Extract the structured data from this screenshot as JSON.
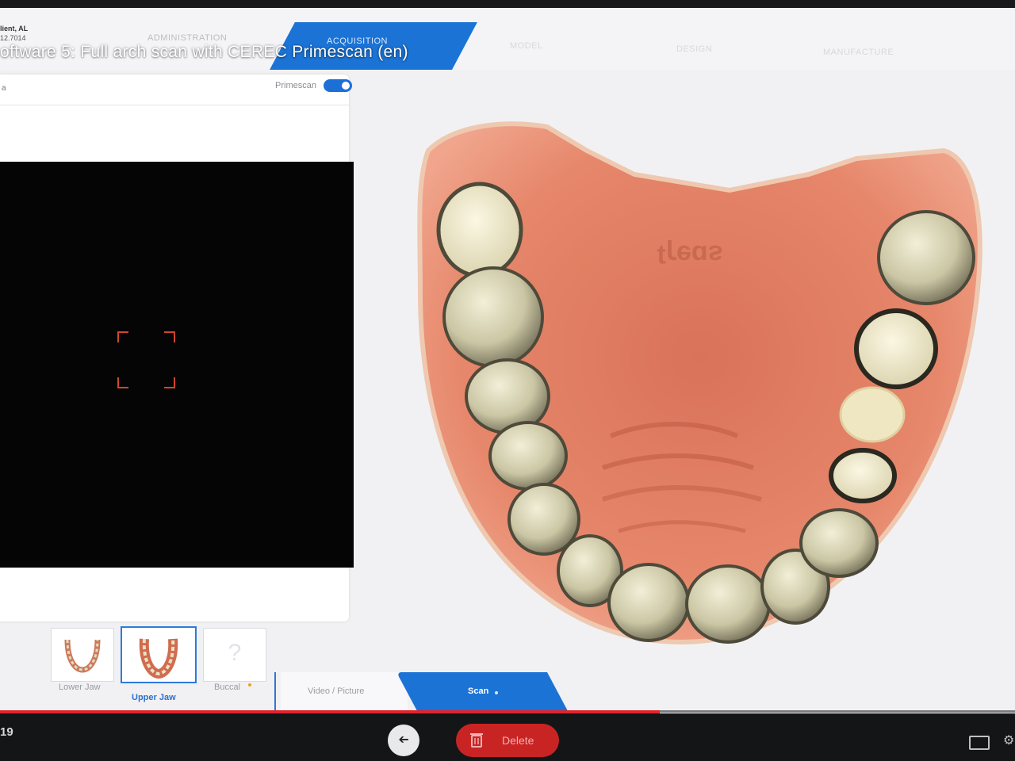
{
  "topbar": {
    "patient_name": "lient, AL",
    "patient_meta": "12.7014",
    "steps": {
      "administration": "ADMINISTRATION",
      "acquisition": "ACQUISITION",
      "model": "MODEL",
      "design": "DESIGN",
      "manufacture": "MANUFACTURE"
    },
    "overlay_title": "oftware 5: Full arch scan with CEREC Primescan (en)"
  },
  "camera_panel": {
    "header_label": "a",
    "device_label": "Primescan",
    "device_toggle_on": true
  },
  "catalog": {
    "lower_jaw": "Lower Jaw",
    "upper_jaw": "Upper Jaw",
    "buccal": "Buccal",
    "buccal_placeholder": "?"
  },
  "workflow": {
    "video_picture": "Video / Picture",
    "scan": "Scan"
  },
  "bottombar": {
    "time": "19",
    "back_symbol": "➔",
    "delete": "Delete"
  },
  "colors": {
    "accent": "#1b73d6",
    "delete": "#c92424",
    "progress": "#e0242c",
    "gum": "#e27a5e",
    "tooth": "#cfc9a8"
  }
}
